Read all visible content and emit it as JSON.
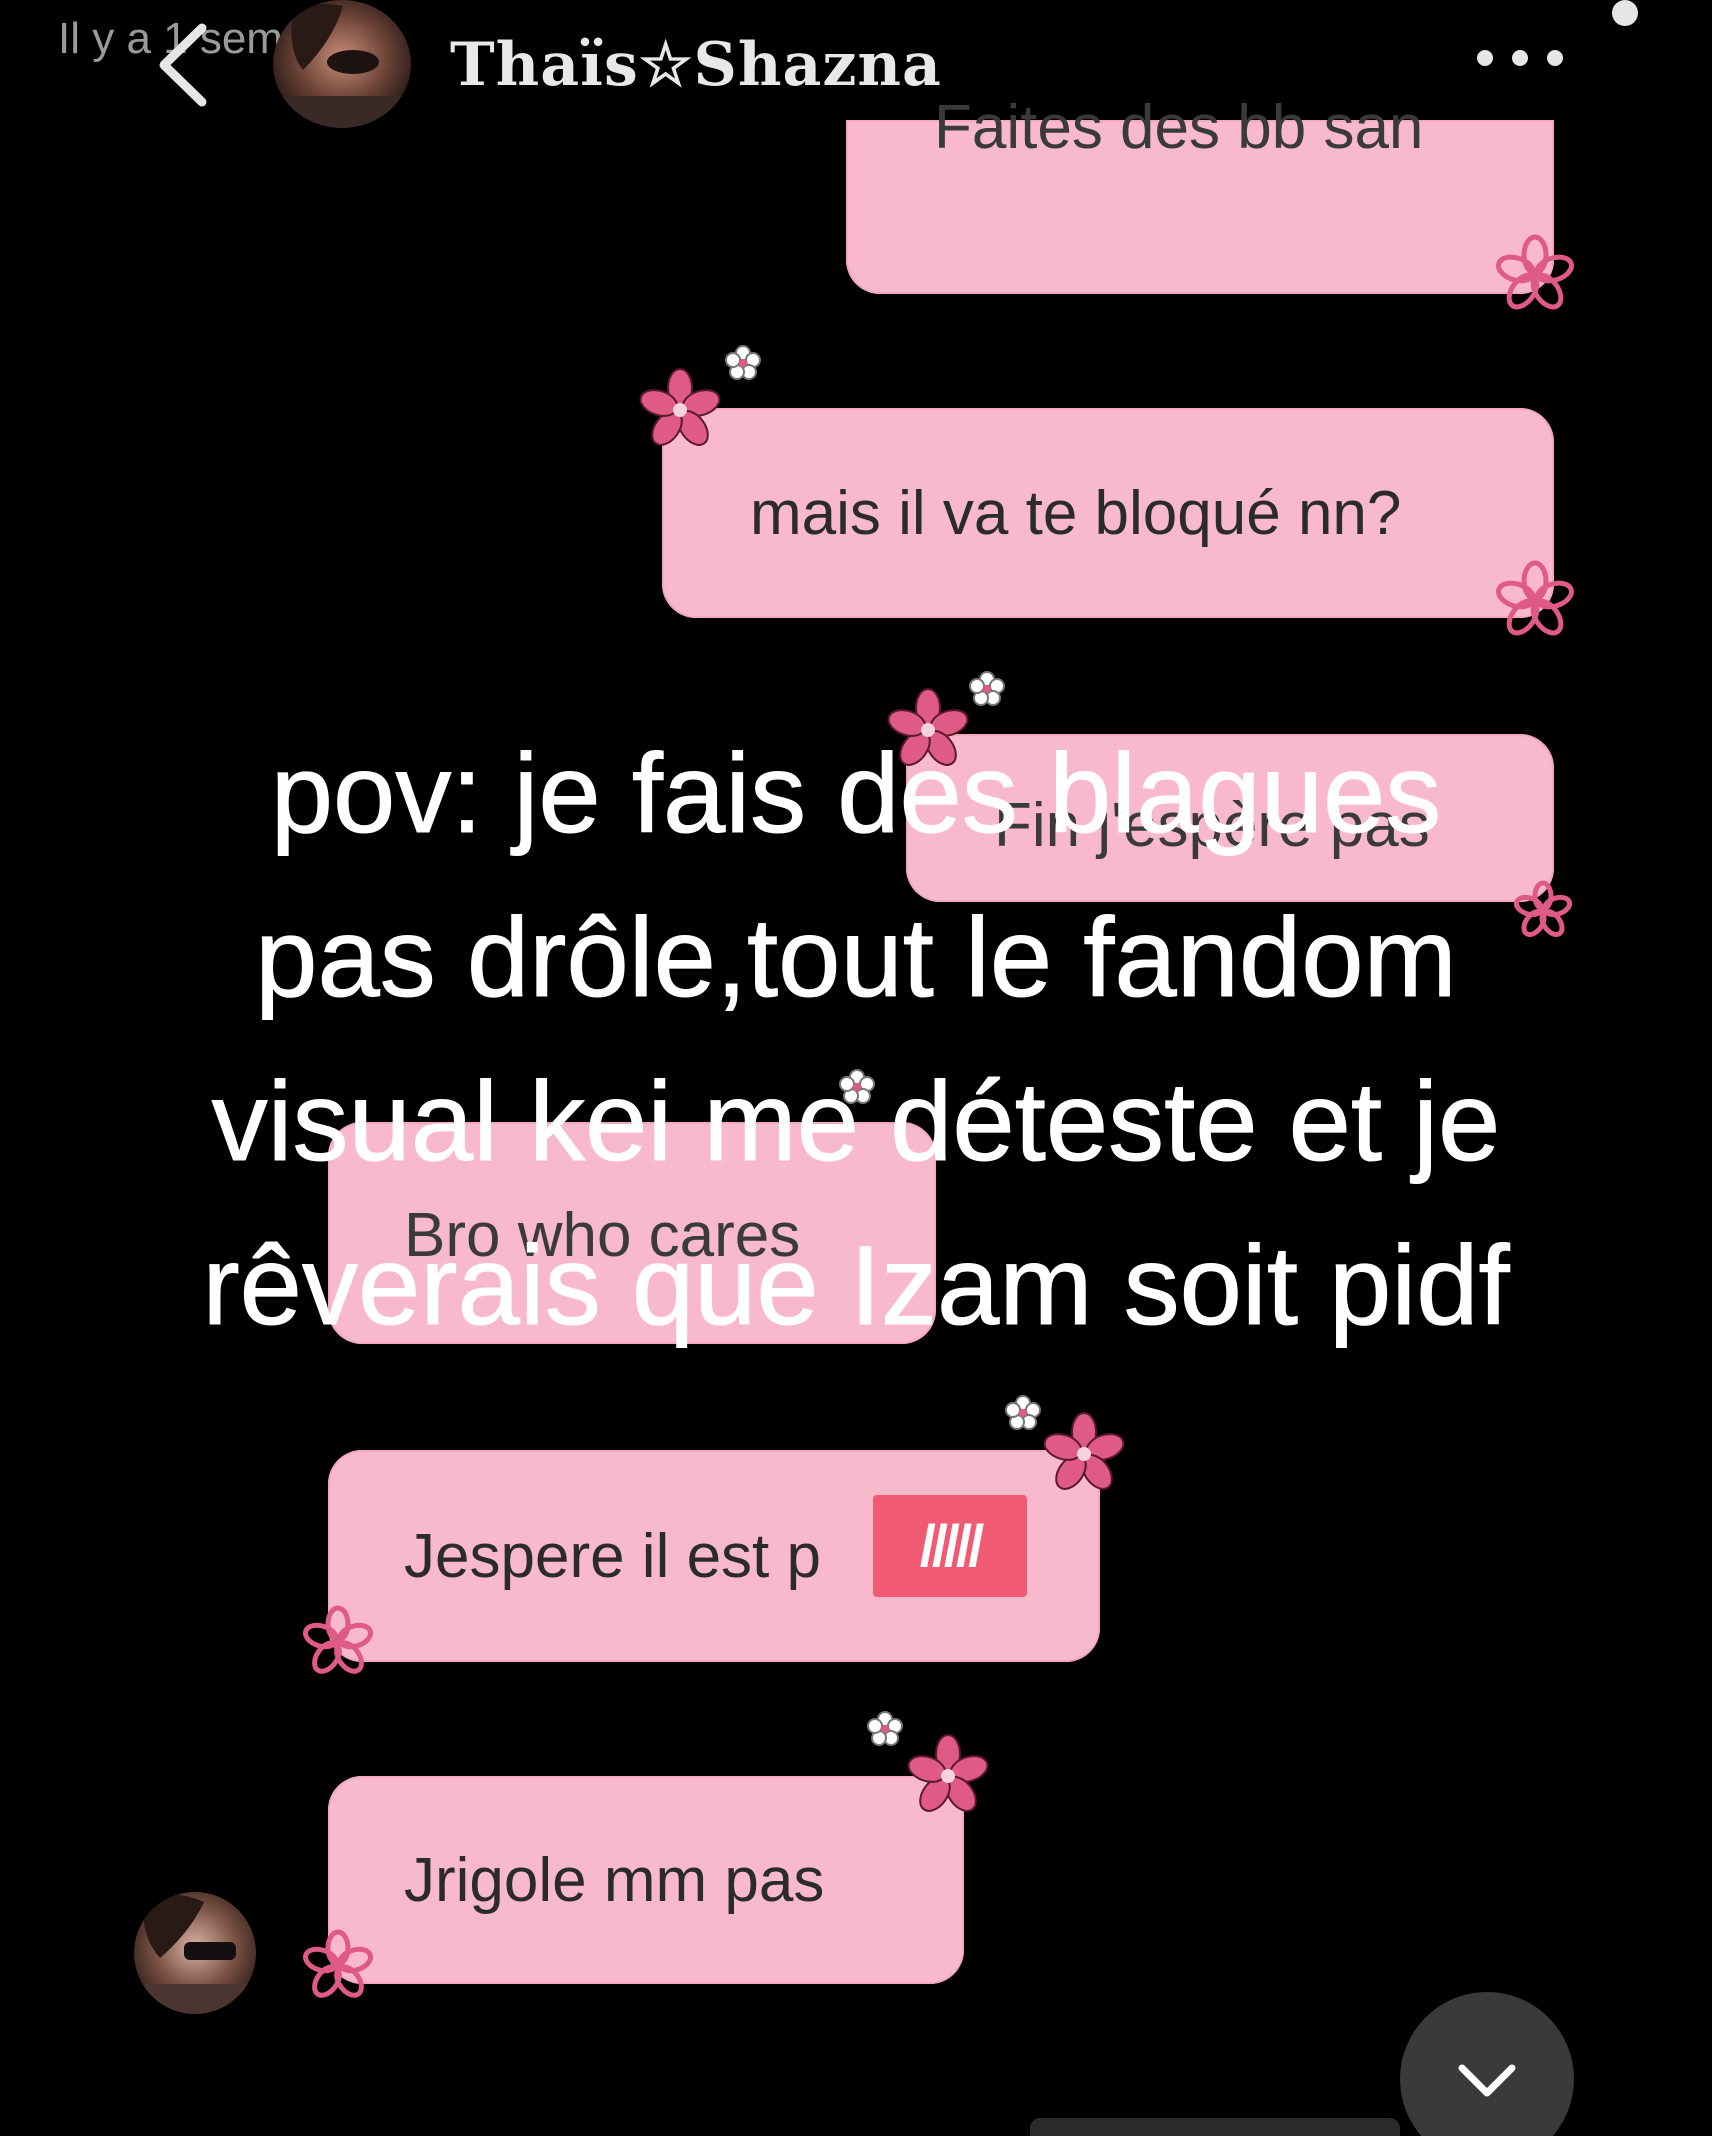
{
  "header": {
    "time_ago": "Il y a 1 sem.",
    "username": "Thaïs☆Shazna",
    "back_icon": "chevron-left-icon",
    "more_icon": "more-horizontal-icon"
  },
  "messages": [
    {
      "text": "Faites des bb san"
    },
    {
      "text": "mais il va te bloqué nn?"
    },
    {
      "text": "Fin j'espère pas"
    },
    {
      "text": "Bro who cares"
    },
    {
      "text": "Jespere il est p",
      "redaction": "/////"
    },
    {
      "text": "Jrigole mm pas"
    }
  ],
  "caption": {
    "lines": [
      "pov: je fais des blagues",
      "pas drôle,tout le fandom",
      "visual kei me déteste et je",
      "rêverais que Izam soit pidf"
    ]
  },
  "colors": {
    "background": "#000000",
    "bubble": "#f9b9cd",
    "flower": "#e05a86",
    "redaction": "#f05a72"
  },
  "scroll_button_icon": "chevron-down-icon"
}
